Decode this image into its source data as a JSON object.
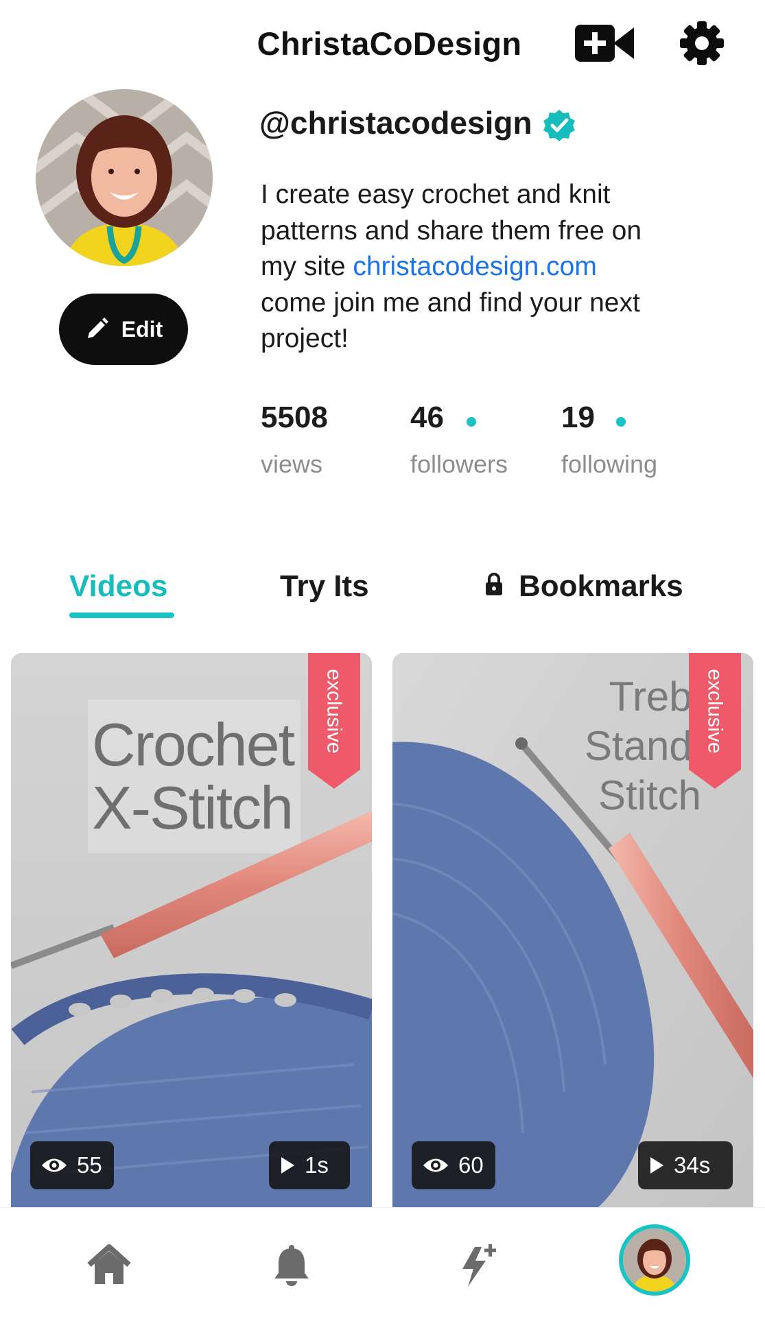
{
  "header": {
    "title": "ChristaCoDesign",
    "icons": [
      "add-video-icon",
      "settings-icon"
    ]
  },
  "profile": {
    "handle": "@christacodesign",
    "verified": true,
    "edit_label": "Edit",
    "bio_line1": "I create easy crochet and knit",
    "bio_line2": "patterns and share them free on",
    "bio_line3_prefix": "my site ",
    "bio_link": "christacodesign.com",
    "bio_line4": "come join me and find your next",
    "bio_line5": "project!"
  },
  "stats": [
    {
      "value": "5508",
      "label": "views"
    },
    {
      "value": "46",
      "label": "followers"
    },
    {
      "value": "19",
      "label": "following"
    }
  ],
  "tabs": [
    {
      "label": "Videos",
      "active": true
    },
    {
      "label": "Try Its",
      "active": false
    },
    {
      "label": "Bookmarks",
      "active": false,
      "icon": "lock-icon"
    }
  ],
  "videos": [
    {
      "title_line1": "Crochet",
      "title_line2": "X-Stitch",
      "badge": "exclusive",
      "views": "55",
      "duration": "1s"
    },
    {
      "title_line1": "Trebl",
      "title_line2": "Standi",
      "title_line3": "Stitch",
      "badge": "exclusive",
      "views": "60",
      "duration": "34s"
    }
  ],
  "bottom_nav": [
    "home-icon",
    "bell-icon",
    "lightning-plus-icon",
    "profile-avatar"
  ],
  "colors": {
    "accent": "#19c3c3",
    "link": "#1a73e8",
    "ribbon": "#ee5a6a",
    "yarn": "#5e77ad"
  }
}
